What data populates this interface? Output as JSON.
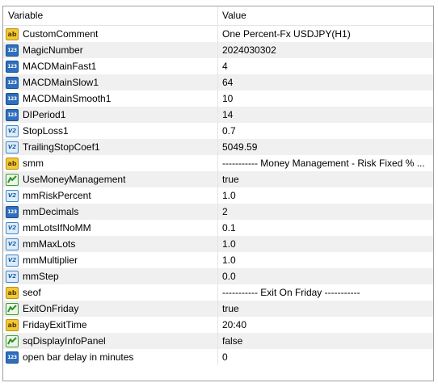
{
  "header": {
    "variable": "Variable",
    "value": "Value"
  },
  "icon_glyphs": {
    "int": "123",
    "string": "ab",
    "double": "V2"
  },
  "colors": {
    "alt_row": "#f0f0f0",
    "int_icon": "#2e6fbe",
    "string_icon": "#f2c935",
    "double_icon": "#dcecfa",
    "bool_icon": "#3f9a35"
  },
  "rows": [
    {
      "name": "CustomComment",
      "value": "One Percent-Fx USDJPY(H1)",
      "type": "string",
      "icon": "string-icon"
    },
    {
      "name": "MagicNumber",
      "value": "2024030302",
      "type": "int",
      "icon": "integer-icon"
    },
    {
      "name": "MACDMainFast1",
      "value": "4",
      "type": "int",
      "icon": "integer-icon"
    },
    {
      "name": "MACDMainSlow1",
      "value": "64",
      "type": "int",
      "icon": "integer-icon"
    },
    {
      "name": "MACDMainSmooth1",
      "value": "10",
      "type": "int",
      "icon": "integer-icon"
    },
    {
      "name": "DIPeriod1",
      "value": "14",
      "type": "int",
      "icon": "integer-icon"
    },
    {
      "name": "StopLoss1",
      "value": "0.7",
      "type": "double",
      "icon": "double-icon"
    },
    {
      "name": "TrailingStopCoef1",
      "value": "5049.59",
      "type": "double",
      "icon": "double-icon"
    },
    {
      "name": "smm",
      "value": "----------- Money Management - Risk Fixed % ...",
      "type": "string",
      "icon": "string-icon"
    },
    {
      "name": "UseMoneyManagement",
      "value": "true",
      "type": "bool",
      "icon": "boolean-icon"
    },
    {
      "name": "mmRiskPercent",
      "value": "1.0",
      "type": "double",
      "icon": "double-icon"
    },
    {
      "name": "mmDecimals",
      "value": "2",
      "type": "int",
      "icon": "integer-icon"
    },
    {
      "name": "mmLotsIfNoMM",
      "value": "0.1",
      "type": "double",
      "icon": "double-icon"
    },
    {
      "name": "mmMaxLots",
      "value": "1.0",
      "type": "double",
      "icon": "double-icon"
    },
    {
      "name": "mmMultiplier",
      "value": "1.0",
      "type": "double",
      "icon": "double-icon"
    },
    {
      "name": "mmStep",
      "value": "0.0",
      "type": "double",
      "icon": "double-icon"
    },
    {
      "name": "seof",
      "value": "----------- Exit On Friday -----------",
      "type": "string",
      "icon": "string-icon"
    },
    {
      "name": "ExitOnFriday",
      "value": "true",
      "type": "bool",
      "icon": "boolean-icon"
    },
    {
      "name": "FridayExitTime",
      "value": "20:40",
      "type": "string",
      "icon": "string-icon"
    },
    {
      "name": "sqDisplayInfoPanel",
      "value": "false",
      "type": "bool",
      "icon": "boolean-icon"
    },
    {
      "name": "open bar delay in minutes",
      "value": "0",
      "type": "int",
      "icon": "integer-icon"
    }
  ]
}
